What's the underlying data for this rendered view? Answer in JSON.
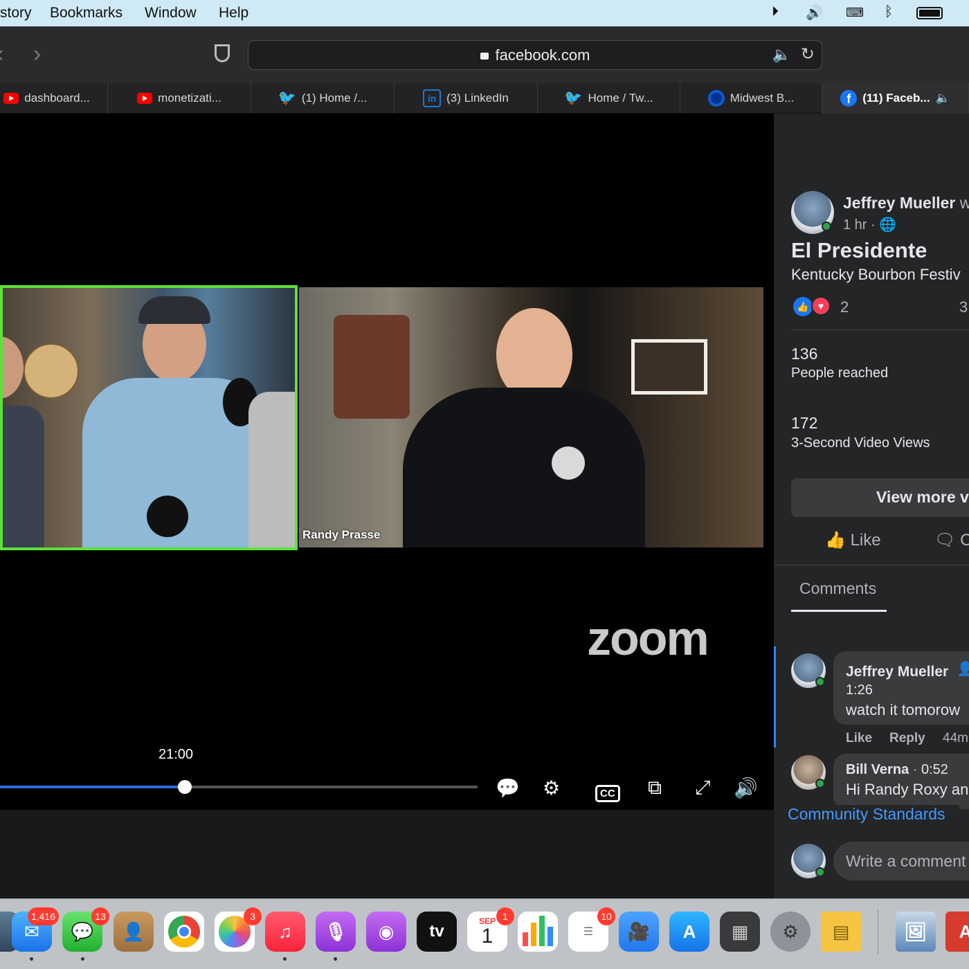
{
  "menubar": {
    "items": [
      "story",
      "Bookmarks",
      "Window",
      "Help"
    ]
  },
  "browser": {
    "back": "‹",
    "forward": "›",
    "url": "facebook.com",
    "tabs": [
      {
        "label": "dashboard...",
        "icon": "youtube-icon"
      },
      {
        "label": "monetizati...",
        "icon": "youtube-icon"
      },
      {
        "label": "(1) Home /...",
        "icon": "twitter-icon"
      },
      {
        "label": "(3) LinkedIn",
        "icon": "linkedin-icon"
      },
      {
        "label": "Home / Tw...",
        "icon": "twitter-icon"
      },
      {
        "label": "Midwest B...",
        "icon": "site-icon"
      },
      {
        "label": "(11) Faceb...",
        "icon": "facebook-icon"
      }
    ]
  },
  "video": {
    "participant_name": "Randy Prasse",
    "logo": "zoom",
    "timestamp": "21:00",
    "progress": 0.387
  },
  "post": {
    "author": "Jeffrey Mueller",
    "author_suffix": "w",
    "time": "1 hr ·",
    "title": "El Presidente",
    "subtitle": "Kentucky Bourbon Festiv",
    "reaction_count": "2",
    "right_count": "3",
    "reached_count": "136",
    "reached_label": "People reached",
    "views_count": "172",
    "views_label": "3-Second Video Views",
    "view_more": "View more v",
    "like_label": "Like",
    "comment_label": "C",
    "comments_tab": "Comments"
  },
  "comments": [
    {
      "author": "Jeffrey Mueller",
      "timestamp": "1:26",
      "text": "watch it tomorow",
      "like": "Like",
      "reply": "Reply",
      "age": "44m"
    },
    {
      "author": "Bill Verna",
      "separator": "·",
      "timestamp": "0:52",
      "text": "Hi Randy Roxy an"
    }
  ],
  "community_standards": "Community Standards",
  "write_placeholder": "Write a comment",
  "dock": {
    "badges": {
      "mail": "1,416",
      "messages": "13",
      "photos": "3",
      "calendar": "1",
      "reminders": "10"
    },
    "calendar_month": "SEP",
    "calendar_day": "1",
    "tv_label": "tv"
  },
  "colors": {
    "facebook_blue": "#1877f2",
    "active_speaker": "#5ce13a",
    "progress_blue": "#2d6be0",
    "panel_bg": "#242526"
  }
}
